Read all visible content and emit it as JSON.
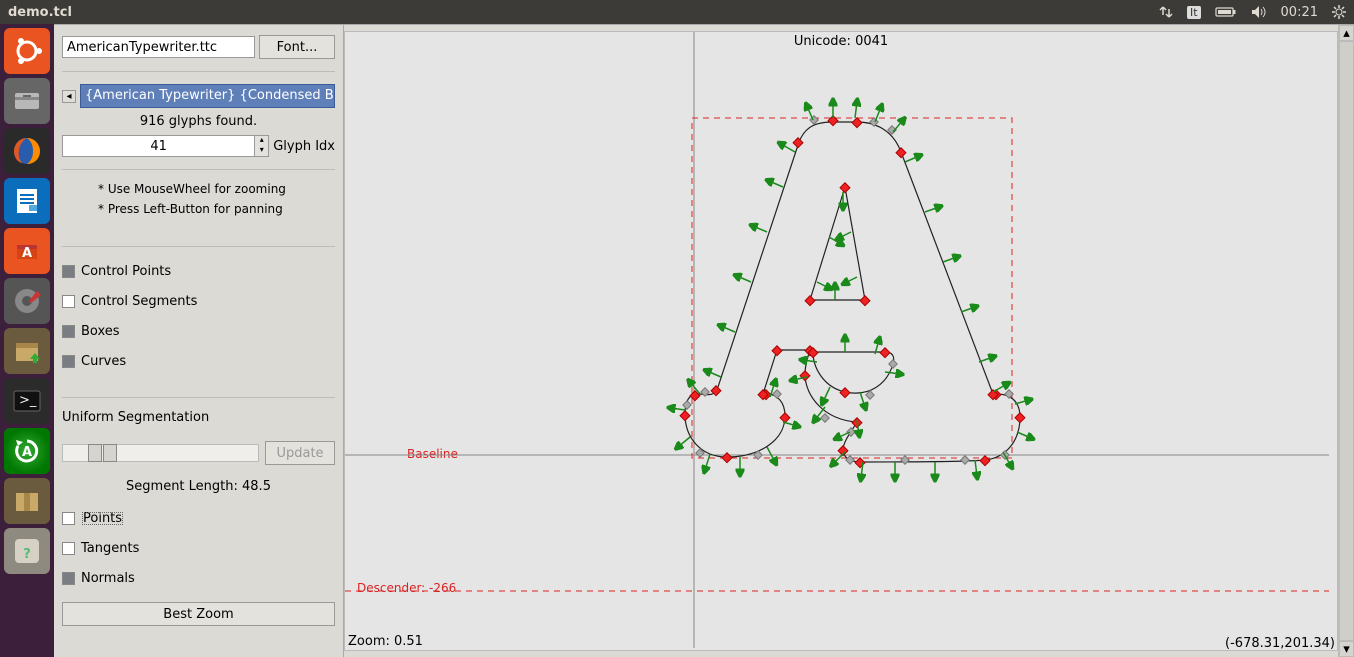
{
  "window": {
    "title": "demo.tcl"
  },
  "system_tray": {
    "lang": "It",
    "time": "00:21"
  },
  "panel": {
    "font_file": "AmericanTypewriter.ttc",
    "font_button": "Font...",
    "font_selected": "{American Typewriter} {Condensed Bold",
    "glyphs_found": "916 glyphs found.",
    "glyph_idx_value": "41",
    "glyph_idx_label": "Glyph Idx",
    "hint1": "* Use MouseWheel for zooming",
    "hint2": "* Press Left-Button for panning",
    "chk_control_points": "Control Points",
    "chk_control_segments": "Control Segments",
    "chk_boxes": "Boxes",
    "chk_curves": "Curves",
    "uniform_segmentation": "Uniform Segmentation",
    "update_button": "Update",
    "segment_length_label": "Segment Length: 48.5",
    "chk_points": "Points",
    "chk_tangents": "Tangents",
    "chk_normals": "Normals",
    "best_zoom": "Best Zoom"
  },
  "canvas": {
    "unicode_label": "Unicode: 0041",
    "baseline": "Baseline",
    "descender": "Descender: -266",
    "zoom": "Zoom: 0.51",
    "coords": "(-678.31,201.34)"
  }
}
